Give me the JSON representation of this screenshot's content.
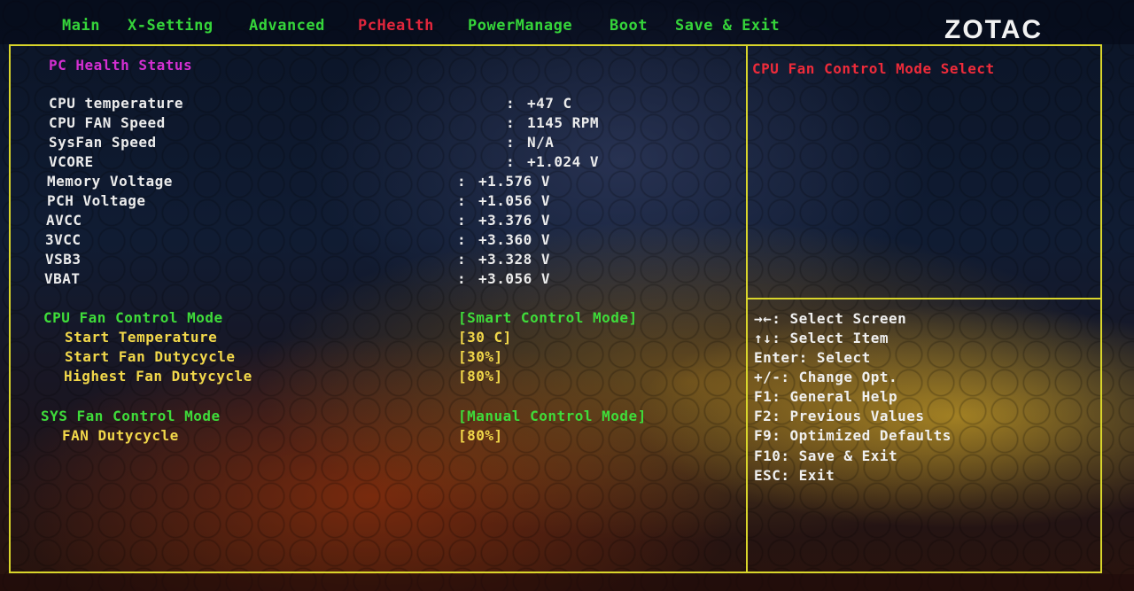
{
  "menu": {
    "items": [
      "Main",
      "X-Setting",
      "Advanced",
      "PcHealth",
      "PowerManage",
      "Boot",
      "Save & Exit"
    ],
    "active": "PcHealth"
  },
  "logo": "ZOTAC",
  "section_title": "PC Health Status",
  "readings": [
    {
      "label": "CPU temperature",
      "value": "+47 C"
    },
    {
      "label": "CPU FAN Speed",
      "value": "1145 RPM"
    },
    {
      "label": "SysFan Speed",
      "value": "N/A"
    },
    {
      "label": "VCORE",
      "value": "+1.024 V"
    },
    {
      "label": "Memory Voltage",
      "value": "+1.576 V"
    },
    {
      "label": "PCH Voltage",
      "value": "+1.056 V"
    },
    {
      "label": "AVCC",
      "value": "+3.376 V"
    },
    {
      "label": "3VCC",
      "value": "+3.360 V"
    },
    {
      "label": "VSB3",
      "value": "+3.328 V"
    },
    {
      "label": "VBAT",
      "value": "+3.056 V"
    }
  ],
  "separator": ":",
  "settings": {
    "cpu_fan_mode": {
      "label": "CPU Fan Control Mode",
      "value": "[Smart Control Mode]"
    },
    "start_temperature": {
      "label": "Start Temperature",
      "value": "[30 C]"
    },
    "start_fan_duty": {
      "label": "Start Fan Dutycycle",
      "value": "[30%]"
    },
    "highest_fan_duty": {
      "label": "Highest Fan Dutycycle",
      "value": "[80%]"
    },
    "sys_fan_mode": {
      "label": "SYS Fan Control Mode",
      "value": "[Manual Control Mode]"
    },
    "fan_duty": {
      "label": "FAN Dutycycle",
      "value": "[80%]"
    }
  },
  "help_title": "CPU Fan Control Mode Select",
  "keys": [
    "→←: Select Screen",
    "↑↓: Select Item",
    "Enter: Select",
    "+/-: Change Opt.",
    "F1: General Help",
    "F2: Previous Values",
    "F9: Optimized Defaults",
    "F10: Save & Exit",
    "ESC: Exit"
  ],
  "colors": {
    "frame": "#d9d52b",
    "menu_text": "#35d43a",
    "menu_active": "#e0263c",
    "section_title": "#d42fd2",
    "help_title": "#ee2b3a",
    "setting_label": "#3fdc3a",
    "sub_setting": "#f2d84a"
  }
}
